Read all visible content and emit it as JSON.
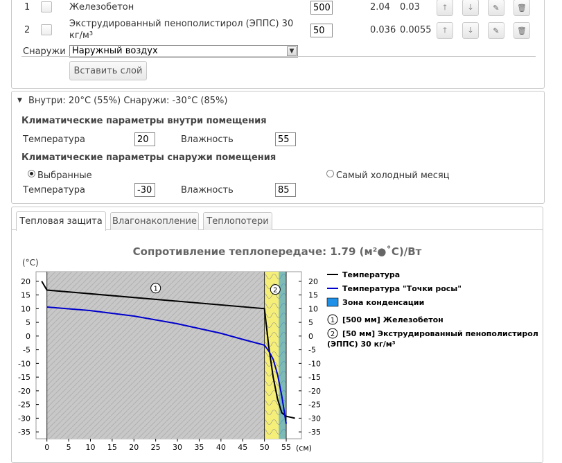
{
  "layers": {
    "rows": [
      {
        "index": "1",
        "name": "Железобетон",
        "thickness": "500",
        "lambda": "2.04",
        "mu": "0.03"
      },
      {
        "index": "2",
        "name_line1": "Экструдированный пенополистирол (ЭППС) 30",
        "name_line2": "кг/м³",
        "thickness": "50",
        "lambda": "0.036",
        "mu": "0.0055"
      }
    ],
    "outside_label": "Снаружи",
    "outside_value": "Наружный воздух",
    "insert_button": "Вставить слой"
  },
  "climate": {
    "header": "Внутри: 20°C (55%) Снаружи: -30°C (85%)",
    "inside_title": "Климатические параметры внутри помещения",
    "temp_label": "Температура",
    "humidity_label": "Влажность",
    "inside_temp": "20",
    "inside_humidity": "55",
    "outside_title": "Климатические параметры снаружи помещения",
    "radio_selected": "Выбранные",
    "radio_coldest": "Самый холодный месяц",
    "outside_temp": "-30",
    "outside_humidity": "85"
  },
  "tabs": [
    "Тепловая защита",
    "Влагонакопление",
    "Теплопотери"
  ],
  "chart_data": {
    "type": "line",
    "title": "Сопротивление теплопередаче: 1.79 (м²●˚C)/Вт",
    "ylabel": "(°C)",
    "xlabel": "(см)",
    "xlim": [
      0,
      55
    ],
    "ylim": [
      -35,
      20
    ],
    "x_ticks": [
      0,
      5,
      10,
      15,
      20,
      25,
      30,
      35,
      40,
      45,
      50,
      55
    ],
    "y_ticks": [
      20,
      15,
      10,
      5,
      0,
      -5,
      -10,
      -15,
      -20,
      -25,
      -30,
      -35
    ],
    "layer_boundaries": [
      0,
      50,
      55
    ],
    "series": [
      {
        "name": "Температура",
        "color": "#000000",
        "points": [
          [
            -1.2,
            20
          ],
          [
            0,
            16.8
          ],
          [
            50,
            10
          ],
          [
            51,
            -4
          ],
          [
            52,
            -15
          ],
          [
            53,
            -23
          ],
          [
            54,
            -28
          ],
          [
            55,
            -29.3
          ],
          [
            57,
            -30
          ]
        ]
      },
      {
        "name": "Температура \"Точки росы\"",
        "color": "#0000cc",
        "points": [
          [
            0,
            10.6
          ],
          [
            10,
            9.3
          ],
          [
            20,
            7.3
          ],
          [
            30,
            4.5
          ],
          [
            40,
            1.0
          ],
          [
            45,
            -1.2
          ],
          [
            50,
            -3.3
          ],
          [
            51,
            -5.5
          ],
          [
            52,
            -8.5
          ],
          [
            53,
            -14
          ],
          [
            54,
            -22
          ],
          [
            55,
            -32
          ]
        ]
      }
    ],
    "condensation_zone": {
      "x_from": 53.3,
      "x_to": 55,
      "color": "#1e90e8"
    },
    "legend": [
      {
        "kind": "line",
        "color": "#000000",
        "label": "Температура"
      },
      {
        "kind": "line",
        "color": "#0000cc",
        "label": "Температура \"Точки росы\""
      },
      {
        "kind": "box",
        "color": "#1e90e8",
        "label": "Зона конденсации"
      },
      {
        "kind": "marker",
        "marker": "1",
        "label": "[500 мм] Железобетон"
      },
      {
        "kind": "marker",
        "marker": "2",
        "label": "[50 мм] Экструдированный пенополистирол",
        "label2": "(ЭППС) 30 кг/м³"
      }
    ],
    "layer_markers": [
      "1",
      "2"
    ]
  }
}
